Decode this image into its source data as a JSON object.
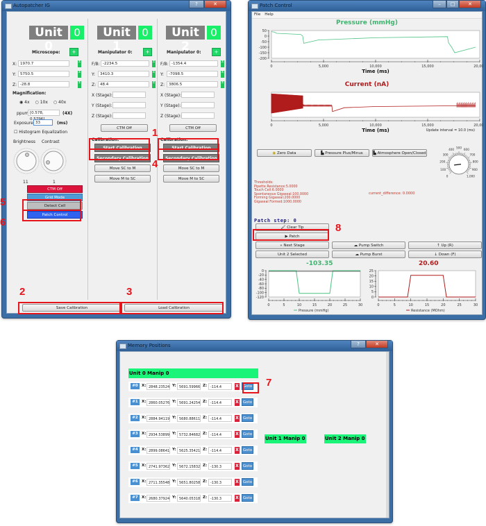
{
  "autopatcher": {
    "title": "Autopatcher IG",
    "units": [
      {
        "name": "Unit 0",
        "count": "0"
      },
      {
        "name": "Unit 1",
        "count": "0"
      },
      {
        "name": "Unit 2",
        "count": "0"
      }
    ],
    "microscope": {
      "label": "Microscope:",
      "add": "+",
      "x_label": "X:",
      "x": "1970.7",
      "y_label": "Y:",
      "y": "5750.5",
      "z_label": "Z:",
      "z": "-28.8",
      "magnification_label": "Magnification:",
      "mag_options": [
        "4x",
        "10x",
        "40x"
      ],
      "mag_selected": "4x",
      "ppum_label": "ppum:",
      "ppum": "[0.578, 0.5796]",
      "ppum_suffix": "(4X)",
      "exposure_label": "Exposure:",
      "exposure": "33",
      "exposure_unit": "(ms)",
      "histogram_label": "Histogram Equalization",
      "brightness_label": "Brightness",
      "contrast_label": "Contrast",
      "brightness_value": "11",
      "contrast_value": "1",
      "ctm_off": "CTM Off",
      "grid_mode": "Grid Mode",
      "detect_cell": "Detect Cell",
      "patch_control": "Patch Control"
    },
    "manipulators": [
      {
        "label": "Manipulator 0:",
        "add": "+",
        "fb_label": "F/B:",
        "fb": "-2234.5",
        "y_label": "Y:",
        "y": "3410.3",
        "z_label": "Z:",
        "z": "48.4",
        "xs_label": "X (Stage):",
        "ys_label": "Y (Stage):",
        "zs_label": "Z (Stage):",
        "ctm_off": "CTM Off",
        "calibration_label": "Calibration:",
        "start_calibration": "Start Calibration",
        "secondary_calibration": "Secondary Calibration",
        "move_sc_to_m": "Move SC to M",
        "move_m_to_sc": "Move M to SC"
      },
      {
        "label": "Manipulator 0:",
        "add": "+",
        "fb_label": "F/B:",
        "fb": "-1354.4",
        "y_label": "Y:",
        "y": "-7098.5",
        "z_label": "Z:",
        "z": "3806.5",
        "xs_label": "X (Stage):",
        "ys_label": "Y (Stage):",
        "zs_label": "Z (Stage):",
        "ctm_off": "CTM Off",
        "calibration_label": "Calibration:",
        "start_calibration": "Start Calibration",
        "secondary_calibration": "Secondary Calibration",
        "move_sc_to_m": "Move SC to M",
        "move_m_to_sc": "Move M to SC"
      }
    ],
    "save_calibration": "Save Calibration",
    "load_calibration": "Load Calibration"
  },
  "patch_control": {
    "title": "Patch Control",
    "menu": [
      "File",
      "Help"
    ],
    "update_interval": "Update interval = 10.0 (ms)",
    "buttons": {
      "zero_data": "Zero Data",
      "pressure_plus_minus": "Pressure Plus/Minus",
      "atmosphere": "Atmosphere Open/Closed",
      "clear_tip": "Clear Tip",
      "patch": "Patch",
      "next_stage": "Next Stage",
      "pump_switch": "Pump Switch",
      "up": "Up (R)",
      "unit_selected": "Unit 2 Selected",
      "pump_burst": "Pump Burst",
      "down": "Down (F)"
    },
    "thresholds": [
      "Thresholds:",
      "Pipette Resistance:5.0000",
      "Touch Cell:6.0000",
      "Spontaneous Gigaseal:100.0000",
      "Forming Gigaseal:200.0000",
      "Gigaseal Formed:1000.0000"
    ],
    "current_difference": "current_difference: 0.0000",
    "patch_step": "Patch step: 0",
    "pressure_readout": "-103.35",
    "resistance_readout": "20.60",
    "dial": {
      "labels": [
        "0",
        "100",
        "200",
        "300",
        "400",
        "500",
        "600",
        "700",
        "800",
        "900",
        "1,000"
      ],
      "value": 140
    }
  },
  "memory": {
    "title": "Memory Positions",
    "unit0_title": "Unit 0 Manip 0",
    "unit1_title": "Unit 1 Manip 0",
    "unit2_title": "Unit 2 Manip 0",
    "x_label": "X:",
    "y_label": "Y:",
    "z_label": "Z:",
    "delete_label": "X",
    "goto_label": "Goto",
    "rows": [
      {
        "idx": "#0",
        "x": "2848.23524",
        "y": "5691.59966",
        "z": "-114.4"
      },
      {
        "idx": "#1",
        "x": "2860.05276",
        "y": "5691.24254",
        "z": "-114.4"
      },
      {
        "idx": "#2",
        "x": "2884.94119",
        "y": "5680.88611",
        "z": "-114.4"
      },
      {
        "idx": "#3",
        "x": "2934.53899",
        "y": "5732.84682",
        "z": "-114.4"
      },
      {
        "idx": "#4",
        "x": "2899.08641",
        "y": "5625.35421",
        "z": "-114.4"
      },
      {
        "idx": "#5",
        "x": "2741.97362",
        "y": "5672.15832",
        "z": "-130.3"
      },
      {
        "idx": "#6",
        "x": "2711.35548",
        "y": "5651.80258",
        "z": "-130.3"
      },
      {
        "idx": "#7",
        "x": "2680.37924",
        "y": "5640.05318",
        "z": "-130.3"
      }
    ]
  },
  "callouts": [
    "1",
    "2",
    "3",
    "4",
    "5",
    "6",
    "7",
    "8"
  ],
  "chart_data": [
    {
      "type": "line",
      "title": "Pressure (mmHg)",
      "xlabel": "Time (ms)",
      "ylabel": "",
      "xlim": [
        0,
        20000
      ],
      "ylim": [
        -200,
        50
      ],
      "xticks": [
        "0",
        "5,000",
        "10,000",
        "15,000",
        "20,000"
      ],
      "yticks": [
        "50",
        "0",
        "-50",
        "-100",
        "-150",
        "-200"
      ],
      "color": "#4cc383",
      "x": [
        0,
        300,
        500,
        2800,
        3000,
        3100,
        4500,
        10000,
        16900,
        17000,
        17300,
        17600,
        19600
      ],
      "y": [
        40,
        35,
        25,
        15,
        0,
        -65,
        -35,
        -15,
        -5,
        -60,
        -100,
        -150,
        -100
      ]
    },
    {
      "type": "line",
      "title": "Current (nA)",
      "xlabel": "Time (ms)",
      "ylabel": "",
      "xlim": [
        0,
        20000
      ],
      "ylim": [
        -0.3,
        0.35
      ],
      "xticks": [
        "0",
        "5,000",
        "10,000",
        "15,000",
        "20,000"
      ],
      "color": "#b01c1c",
      "x": [
        0,
        3000,
        3100,
        5800,
        5850,
        7000,
        10000,
        17800,
        19600
      ],
      "y": [
        0.1,
        0.05,
        0.0,
        0.0,
        -0.15,
        -0.05,
        -0.02,
        0.0,
        0.0
      ],
      "note": "dense oscillation 0-3000 ms (amplitude ~0.3 nA) and 17800-19600 ms"
    },
    {
      "type": "line",
      "title": "",
      "legend": "Pressure (mmHg)",
      "xlim": [
        0,
        30
      ],
      "ylim": [
        -120,
        0
      ],
      "xticks": [
        "0",
        "5",
        "10",
        "15",
        "20",
        "25",
        "30"
      ],
      "yticks": [
        "0",
        "-20",
        "-40",
        "-60",
        "-80",
        "-100",
        "-120"
      ],
      "color": "#4cc383",
      "x": [
        0,
        9,
        10,
        20,
        21,
        30
      ],
      "y": [
        0,
        0,
        -103.35,
        -103.35,
        0,
        0
      ]
    },
    {
      "type": "line",
      "title": "",
      "legend": "Resistance (MOhm)",
      "xlim": [
        0,
        30
      ],
      "ylim": [
        0,
        25
      ],
      "xticks": [
        "0",
        "5",
        "10",
        "15",
        "20",
        "25",
        "30"
      ],
      "yticks": [
        "25",
        "20",
        "15",
        "10",
        "5",
        "0"
      ],
      "color": "#b01c1c",
      "x": [
        0,
        9,
        10,
        20,
        21,
        30
      ],
      "y": [
        0,
        0,
        20.6,
        20.6,
        0,
        0
      ]
    }
  ]
}
